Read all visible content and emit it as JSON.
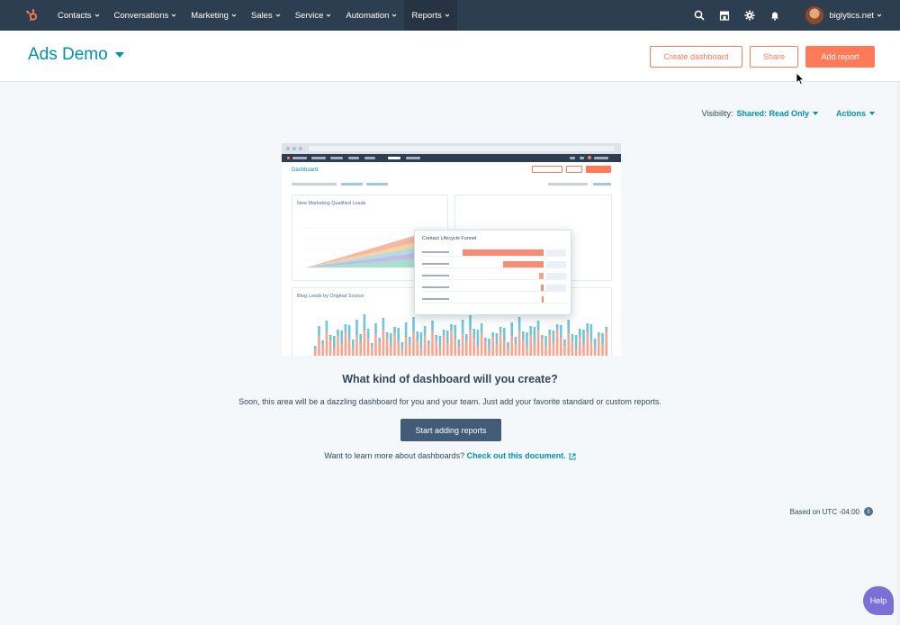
{
  "nav": {
    "items": [
      {
        "label": "Contacts"
      },
      {
        "label": "Conversations"
      },
      {
        "label": "Marketing"
      },
      {
        "label": "Sales"
      },
      {
        "label": "Service"
      },
      {
        "label": "Automation"
      },
      {
        "label": "Reports"
      }
    ],
    "account": "biglytics.net"
  },
  "header": {
    "title": "Ads Demo",
    "create_dashboard": "Create dashboard",
    "share": "Share",
    "add_report": "Add report"
  },
  "visibility": {
    "label": "Visibility:",
    "value": "Shared: Read Only",
    "actions": "Actions"
  },
  "illustration": {
    "dashboard": "Dashboard",
    "card1_title": "New Marketing Qualified Leads",
    "card2_title": "Blog Leads by Original Source",
    "funnel_title": "Contact Lifecycle Funnel"
  },
  "empty": {
    "title": "What kind of dashboard will you create?",
    "description": "Soon, this area will be a dazzling dashboard for you and your team. Just add your favorite standard or custom reports.",
    "button": "Start adding reports",
    "learn_prefix": "Want to learn more about dashboards?",
    "learn_link": "Check out this document."
  },
  "timezone": "Based on UTC -04:00",
  "help": "Help",
  "colors": {
    "nav_bg": "#2d3e50",
    "accent": "#ff7a59",
    "link": "#0091ae",
    "primary_dark": "#425b76"
  }
}
